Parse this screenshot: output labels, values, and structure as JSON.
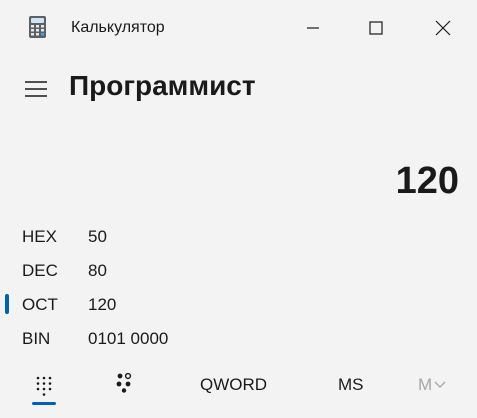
{
  "window": {
    "title": "Калькулятор"
  },
  "header": {
    "mode_title": "Программист"
  },
  "display": {
    "value": "120"
  },
  "radix": [
    {
      "label": "HEX",
      "value": "50",
      "selected": false
    },
    {
      "label": "DEC",
      "value": "80",
      "selected": false
    },
    {
      "label": "OCT",
      "value": "120",
      "selected": true
    },
    {
      "label": "BIN",
      "value": "0101 0000",
      "selected": false
    }
  ],
  "toolbar": {
    "word_size_label": "QWORD",
    "memory_store_label": "MS",
    "memory_view_label": "M",
    "selected_pad": "full-keypad"
  },
  "colors": {
    "background": "#f3f3f3",
    "accent": "#005fb8",
    "text": "#1a1a1a",
    "disabled_text": "#a6a6a6"
  }
}
